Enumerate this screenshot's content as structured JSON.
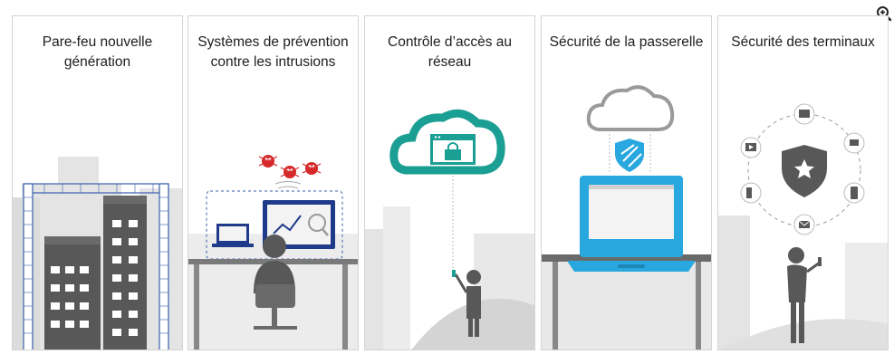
{
  "toolbar": {
    "zoom_icon": "zoom-in-icon"
  },
  "panels": [
    {
      "title": "Pare-feu nouvelle génération",
      "icon": "firewall-buildings-icon"
    },
    {
      "title": "Systèmes de prévention contre les intrusions",
      "icon": "intrusion-prevention-icon"
    },
    {
      "title": "Contrôle d’accès au réseau",
      "icon": "cloud-lock-icon"
    },
    {
      "title": "Sécurité de la passerelle",
      "icon": "laptop-cloud-shield-icon"
    },
    {
      "title": "Sécurité des terminaux",
      "icon": "endpoint-shield-icon"
    }
  ],
  "colors": {
    "firewall_blue": "#3a5fae",
    "threat_red": "#d62a2a",
    "teal": "#1b9e93",
    "laptop_blue": "#29a7df",
    "dark_gray": "#585858",
    "light_gray": "#c9c9c9"
  }
}
